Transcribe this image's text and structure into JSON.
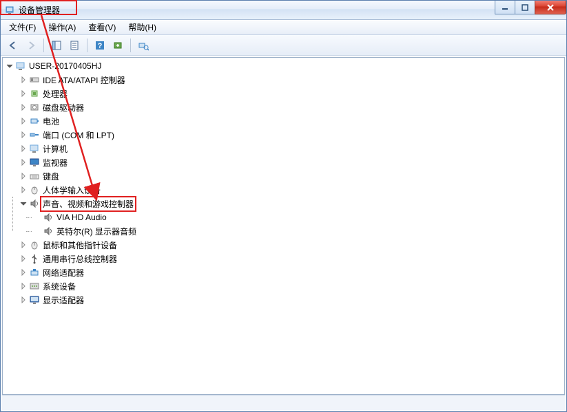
{
  "window": {
    "title": "设备管理器"
  },
  "menu": {
    "file": "文件(F)",
    "action": "操作(A)",
    "view": "查看(V)",
    "help": "帮助(H)"
  },
  "tree": {
    "root": "USER-20170405HJ",
    "items": [
      {
        "label": "IDE ATA/ATAPI 控制器",
        "icon": "ide"
      },
      {
        "label": "处理器",
        "icon": "cpu"
      },
      {
        "label": "磁盘驱动器",
        "icon": "disk"
      },
      {
        "label": "电池",
        "icon": "battery"
      },
      {
        "label": "端口 (COM 和 LPT)",
        "icon": "port"
      },
      {
        "label": "计算机",
        "icon": "computer"
      },
      {
        "label": "监视器",
        "icon": "monitor"
      },
      {
        "label": "键盘",
        "icon": "keyboard"
      },
      {
        "label": "人体学输入设备",
        "icon": "hid"
      },
      {
        "label": "声音、视频和游戏控制器",
        "icon": "sound",
        "expanded": true,
        "highlighted": true,
        "children": [
          {
            "label": "VIA HD Audio",
            "icon": "sound"
          },
          {
            "label": "英特尔(R) 显示器音频",
            "icon": "sound"
          }
        ]
      },
      {
        "label": "鼠标和其他指针设备",
        "icon": "mouse"
      },
      {
        "label": "通用串行总线控制器",
        "icon": "usb"
      },
      {
        "label": "网络适配器",
        "icon": "network"
      },
      {
        "label": "系统设备",
        "icon": "system"
      },
      {
        "label": "显示适配器",
        "icon": "display"
      }
    ]
  }
}
